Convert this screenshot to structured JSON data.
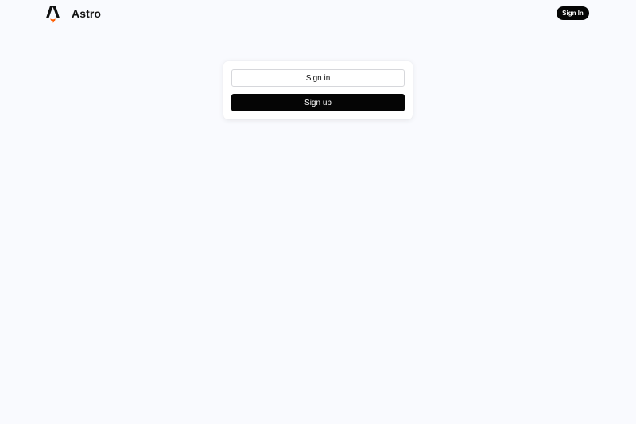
{
  "header": {
    "brand_name": "Astro",
    "signin_label": "Sign In"
  },
  "auth_card": {
    "signin_label": "Sign in",
    "signup_label": "Sign up"
  },
  "colors": {
    "background": "#f9fafe",
    "primary": "#050505",
    "logo_flame": "#ff5d01"
  },
  "icons": {
    "logo": "astro-logo-icon"
  }
}
